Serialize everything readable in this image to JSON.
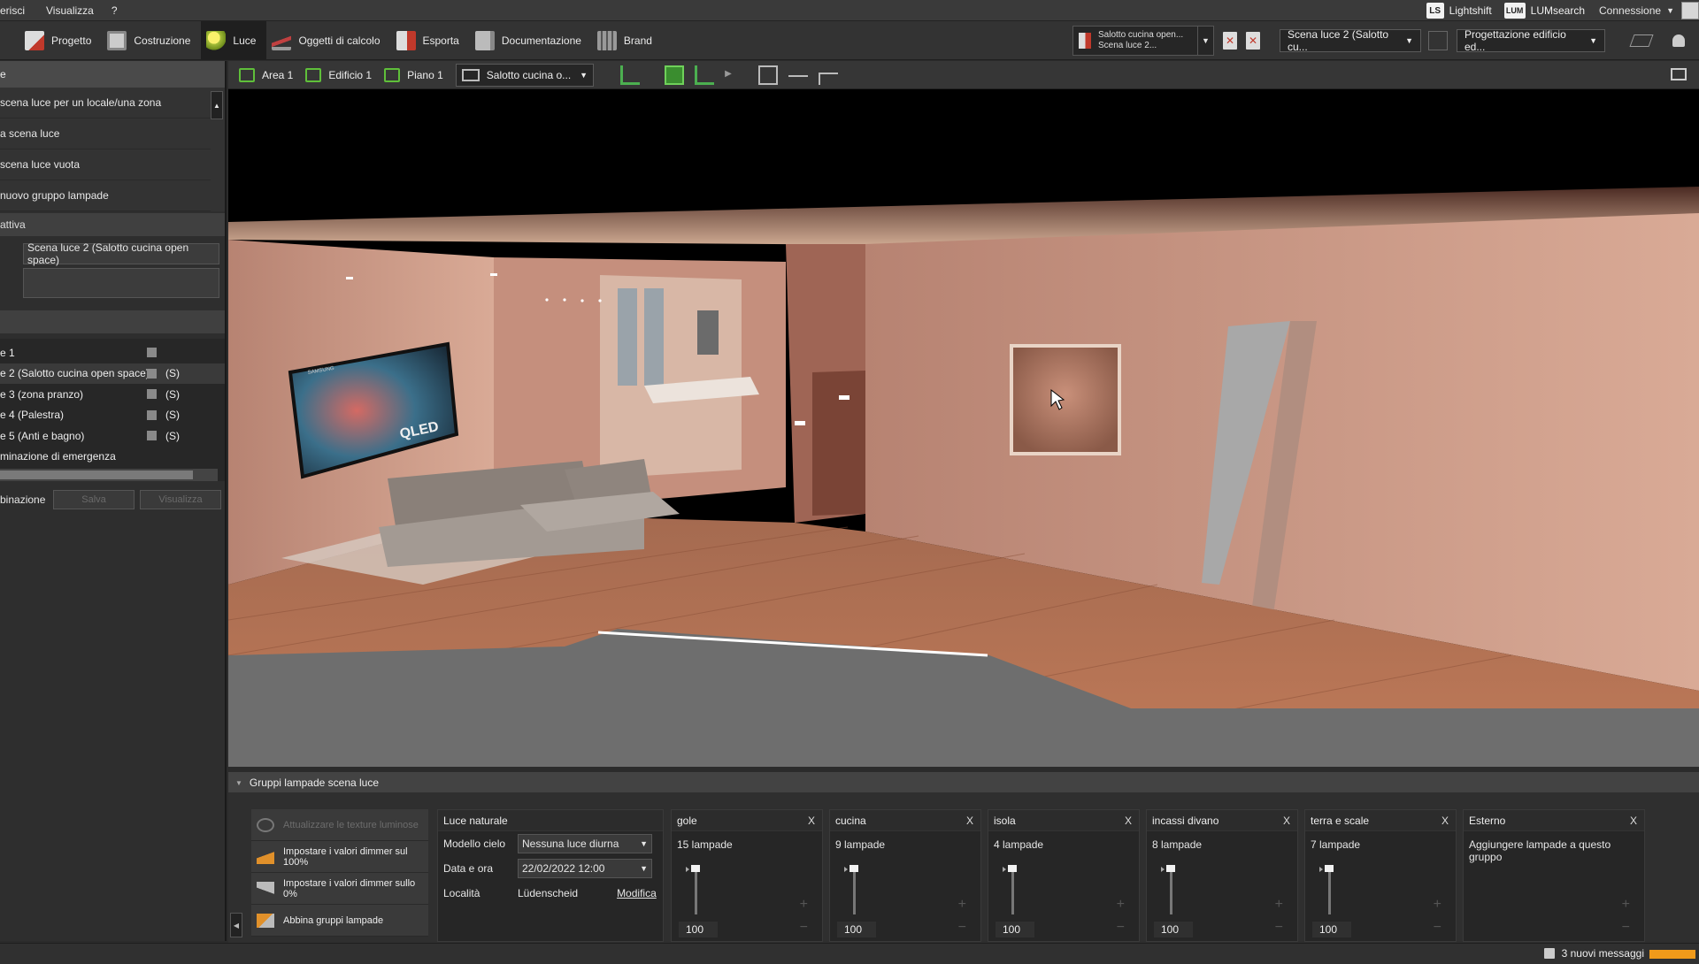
{
  "menubar": {
    "items": [
      "erisci",
      "Visualizza",
      "?"
    ]
  },
  "menu_right": {
    "lightshift": "Lightshift",
    "lumsearch": "LUMsearch",
    "connessione": "Connessione",
    "ls_logo": "LS",
    "lum_logo": "LUM"
  },
  "toolbar": {
    "tabs": [
      {
        "label": "Progetto",
        "icon": "project-icon"
      },
      {
        "label": "Costruzione",
        "icon": "construction-icon"
      },
      {
        "label": "Luce",
        "icon": "light-bulb-icon",
        "active": true
      },
      {
        "label": "Oggetti di calcolo",
        "icon": "calc-objects-icon"
      },
      {
        "label": "Esporta",
        "icon": "export-icon"
      },
      {
        "label": "Documentazione",
        "icon": "documentation-icon"
      },
      {
        "label": "Brand",
        "icon": "brand-icon"
      }
    ],
    "scene_doc": {
      "line1": "Salotto cucina open...",
      "line2": "Scena luce 2..."
    },
    "scene_select": "Scena luce 2 (Salotto cu...",
    "design_select": "Progettazione edificio ed..."
  },
  "left_panel": {
    "header": "e",
    "actions": [
      "scena luce per un locale/una zona",
      "a scena luce",
      "scena luce vuota",
      "nuovo gruppo lampade"
    ],
    "active_header": "attiva",
    "active_scene": "Scena luce 2 (Salotto cucina open space)",
    "scenes": [
      {
        "label": "e 1",
        "tag": ""
      },
      {
        "label": "e 2 (Salotto cucina open space)",
        "tag": "(S)",
        "selected": true
      },
      {
        "label": "e 3 (zona pranzo)",
        "tag": "(S)"
      },
      {
        "label": "e 4 (Palestra)",
        "tag": "(S)"
      },
      {
        "label": "e 5 (Anti e bagno)",
        "tag": "(S)"
      },
      {
        "label": "minazione di emergenza",
        "tag": ""
      }
    ],
    "combo_label": "binazione",
    "combo_btn1": "Salva",
    "combo_btn2": "Visualizza"
  },
  "viewport_toolbar": {
    "crumbs": [
      "Area 1",
      "Edificio 1",
      "Piano 1"
    ],
    "room_select": "Salotto cucina o..."
  },
  "scene_labels": {
    "tv": "QLED",
    "tv_brand": "SAMSUNG"
  },
  "bottom_panel": {
    "title": "Gruppi lampade scena luce",
    "buttons": [
      {
        "label": "Attualizzare le texture luminose",
        "disabled": true
      },
      {
        "label": "Impostare i valori dimmer sul 100%"
      },
      {
        "label": "Impostare i valori dimmer sullo 0%"
      },
      {
        "label": "Abbina gruppi lampade"
      }
    ],
    "natural_light": {
      "title": "Luce naturale",
      "sky_model_label": "Modello cielo",
      "sky_model_value": "Nessuna luce diurna",
      "datetime_label": "Data e ora",
      "datetime_value": "22/02/2022 12:00",
      "location_label": "Località",
      "location_value": "Lüdenscheid",
      "edit_link": "Modifica"
    },
    "groups": [
      {
        "name": "gole",
        "count": "15 lampade",
        "value": "100",
        "close": "X"
      },
      {
        "name": "cucina",
        "count": "9 lampade",
        "value": "100",
        "close": "X"
      },
      {
        "name": "isola",
        "count": "4 lampade",
        "value": "100",
        "close": "X"
      },
      {
        "name": "incassi divano",
        "count": "8 lampade",
        "value": "100",
        "close": "X"
      },
      {
        "name": "terra e scale",
        "count": "7 lampade",
        "value": "100",
        "close": "X"
      }
    ],
    "external": {
      "name": "Esterno",
      "text": "Aggiungere lampade a questo gruppo",
      "close": "X"
    }
  },
  "status": {
    "messages": "3 nuovi messaggi"
  },
  "colors": {
    "accent_green": "#4caf50",
    "notify_orange": "#f09a1a",
    "room_wall": "#c69582",
    "floor": "#9a5c45"
  }
}
